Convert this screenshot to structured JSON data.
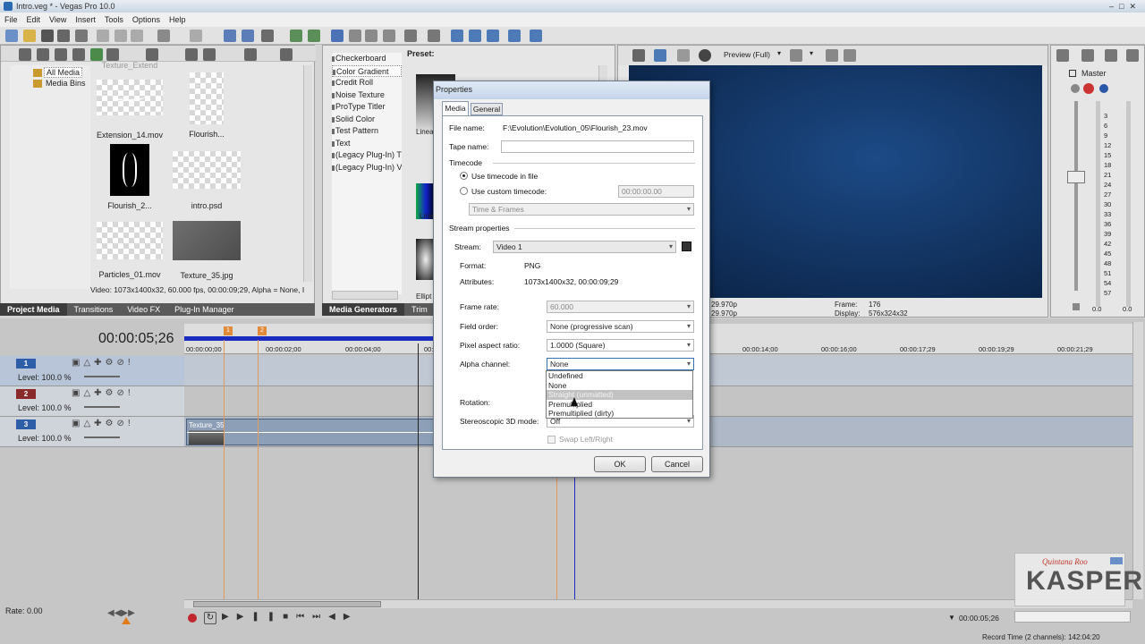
{
  "window": {
    "title": "Intro.veg * - Vegas Pro 10.0"
  },
  "menu": [
    "File",
    "Edit",
    "View",
    "Insert",
    "Tools",
    "Options",
    "Help"
  ],
  "project_media": {
    "tree": [
      "All Media",
      "Media Bins"
    ],
    "partial_top_label": "Texture_Extend",
    "items": [
      {
        "name": "Extension_14.mov"
      },
      {
        "name": "Flourish..."
      },
      {
        "name": "Flourish_2..."
      },
      {
        "name": "intro.psd"
      },
      {
        "name": "Particles_01.mov"
      },
      {
        "name": "Texture_35.jpg"
      }
    ],
    "status": "Video: 1073x1400x32, 60.000 fps, 00:00:09;29, Alpha = None, I"
  },
  "bottom_tabs_left": [
    "Project Media",
    "Transitions",
    "Video FX",
    "Plug-In Manager"
  ],
  "media_generators": {
    "items": [
      "Checkerboard",
      "Color Gradient",
      "Credit Roll",
      "Noise Texture",
      "ProType Titler",
      "Solid Color",
      "Test Pattern",
      "Text",
      "(Legacy Plug-In) T",
      "(Legacy Plug-In) V"
    ],
    "selected": "Color Gradient",
    "preset_label": "Preset:",
    "preset_names": [
      "Linea",
      "Line",
      "Ellipt"
    ],
    "tabs": [
      "Media Generators",
      "Trim"
    ]
  },
  "preview": {
    "mode": "Preview (Full)",
    "info": {
      "left1": "29.970p",
      "left2": "29.970p",
      "frame_label": "Frame:",
      "frame": "176",
      "display_label": "Display:",
      "display": "576x324x32"
    }
  },
  "master": {
    "label": "Master",
    "scale": [
      "3",
      "6",
      "9",
      "12",
      "15",
      "18",
      "21",
      "24",
      "27",
      "30",
      "33",
      "36",
      "39",
      "42",
      "45",
      "48",
      "51",
      "54",
      "57"
    ],
    "left_val": "0.0",
    "right_val": "0.0"
  },
  "timeline": {
    "timecode": "00:00:05;26",
    "markers": [
      "1",
      "2"
    ],
    "ruler": [
      "00:00:00;00",
      "00:00:02;00",
      "00:00:04;00",
      "00:",
      "00:00:14;00",
      "00:00:16;00",
      "00:00:17;29",
      "00:00:19;29",
      "00:00:21;29"
    ],
    "tracks": [
      {
        "num": "1",
        "level": "Level: 100.0 %"
      },
      {
        "num": "2",
        "level": "Level: 100.0 %"
      },
      {
        "num": "3",
        "level": "Level: 100.0 %"
      }
    ],
    "clip": "Texture_35",
    "rate": "Rate: 0.00",
    "end_timecode": "00:00:05;26",
    "record_time": "Record Time (2 channels): 142:04:20"
  },
  "dialog": {
    "title": "Properties",
    "tabs": [
      "Media",
      "General"
    ],
    "file_name_label": "File name:",
    "file_name": "F:\\Evolution\\Evolution_05\\Flourish_23.mov",
    "tape_name_label": "Tape name:",
    "tape_name": "",
    "timecode_section": "Timecode",
    "use_file_tc": "Use timecode in file",
    "use_custom_tc": "Use custom timecode:",
    "custom_tc_value": "00:00:00.00",
    "time_frames": "Time & Frames",
    "stream_section": "Stream properties",
    "stream_label": "Stream:",
    "stream_value": "Video 1",
    "format_label": "Format:",
    "format_value": "PNG",
    "attributes_label": "Attributes:",
    "attributes_value": "1073x1400x32, 00:00:09;29",
    "frame_rate_label": "Frame rate:",
    "frame_rate_value": "60.000",
    "field_order_label": "Field order:",
    "field_order_value": "None (progressive scan)",
    "par_label": "Pixel aspect ratio:",
    "par_value": "1.0000 (Square)",
    "alpha_label": "Alpha channel:",
    "alpha_value": "None",
    "alpha_options": [
      "Undefined",
      "None",
      "Straight (unmatted)",
      "Premultiplied",
      "Premultiplied (dirty)"
    ],
    "alpha_highlighted": "Straight (unmatted)",
    "rotation_label": "Rotation:",
    "stereo_label": "Stereoscopic 3D mode:",
    "stereo_value": "Off",
    "swap_label": "Swap Left/Right",
    "ok": "OK",
    "cancel": "Cancel"
  },
  "watermark": {
    "line1": "Quintana Roo",
    "name": "KASPER"
  }
}
